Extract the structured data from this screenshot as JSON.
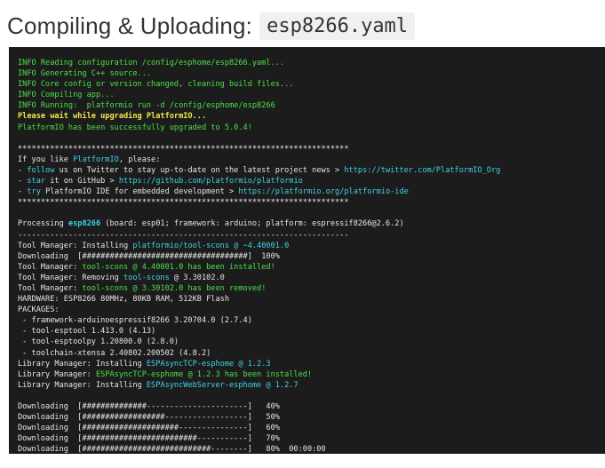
{
  "header": {
    "title": "Compiling & Uploading:",
    "filename": "esp8266.yaml"
  },
  "colors": {
    "terminal_bg": "#1c1c1c",
    "white": "#e6e6e6",
    "green": "#4ae04a",
    "yellow": "#f1e84b",
    "cyan": "#3fd3e6"
  },
  "terminal": {
    "lines": [
      [
        {
          "t": "INFO Reading configuration /config/esphome/esp8266.yaml...",
          "c": "green"
        }
      ],
      [
        {
          "t": "INFO Generating C++ source...",
          "c": "green"
        }
      ],
      [
        {
          "t": "INFO Core config or version changed, cleaning build files...",
          "c": "green"
        }
      ],
      [
        {
          "t": "INFO Compiling app...",
          "c": "green"
        }
      ],
      [
        {
          "t": "INFO Running:  platformio run -d /config/esphome/esp8266",
          "c": "green"
        }
      ],
      [
        {
          "t": "Please wait while upgrading PlatformIO...",
          "c": "yellow",
          "b": true
        }
      ],
      [
        {
          "t": "PlatformIO has been successfully upgraded to 5.0.4!",
          "c": "green"
        }
      ],
      [],
      [
        {
          "t": "************************************************************************",
          "c": "white"
        }
      ],
      [
        {
          "t": "If you like ",
          "c": "white"
        },
        {
          "t": "PlatformIO",
          "c": "cyan"
        },
        {
          "t": ", please:",
          "c": "white"
        }
      ],
      [
        {
          "t": "- ",
          "c": "white"
        },
        {
          "t": "follow",
          "c": "cyan"
        },
        {
          "t": " us on Twitter to stay up-to-date on the latest project news > ",
          "c": "white"
        },
        {
          "t": "https://twitter.com/PlatformIO_Org",
          "c": "cyan"
        }
      ],
      [
        {
          "t": "- ",
          "c": "white"
        },
        {
          "t": "star",
          "c": "cyan"
        },
        {
          "t": " it on GitHub > ",
          "c": "white"
        },
        {
          "t": "https://github.com/platformio/platformio",
          "c": "cyan"
        }
      ],
      [
        {
          "t": "- ",
          "c": "white"
        },
        {
          "t": "try",
          "c": "cyan"
        },
        {
          "t": " PlatformIO IDE for embedded development > ",
          "c": "white"
        },
        {
          "t": "https://platformio.org/platformio-ide",
          "c": "cyan"
        }
      ],
      [
        {
          "t": "************************************************************************",
          "c": "white"
        }
      ],
      [],
      [
        {
          "t": "Processing ",
          "c": "white"
        },
        {
          "t": "esp8266",
          "c": "cyan",
          "b": true
        },
        {
          "t": " (board: esp01; framework: arduino; platform: espressif8266@2.6.2)",
          "c": "white"
        }
      ],
      [
        {
          "t": "------------------------------------------------------------------------",
          "c": "white"
        }
      ],
      [
        {
          "t": "Tool Manager: Installing ",
          "c": "white"
        },
        {
          "t": "platformio/tool-scons @ ~4.40001.0",
          "c": "cyan"
        }
      ],
      [
        {
          "t": "Downloading  [####################################]  100%",
          "c": "white"
        }
      ],
      [
        {
          "t": "Tool Manager: ",
          "c": "white"
        },
        {
          "t": "tool-scons @ 4.40001.0 has been installed!",
          "c": "green"
        }
      ],
      [
        {
          "t": "Tool Manager: Removing ",
          "c": "white"
        },
        {
          "t": "tool-scons",
          "c": "cyan"
        },
        {
          "t": " @ 3.30102.0",
          "c": "white"
        }
      ],
      [
        {
          "t": "Tool Manager: ",
          "c": "white"
        },
        {
          "t": "tool-scons @ 3.30102.0 has been removed!",
          "c": "green"
        }
      ],
      [
        {
          "t": "HARDWARE: ESP8266 80MHz, 80KB RAM, 512KB Flash",
          "c": "white"
        }
      ],
      [
        {
          "t": "PACKAGES:",
          "c": "white"
        }
      ],
      [
        {
          "t": " - framework-arduinoespressif8266 3.20704.0 (2.7.4)",
          "c": "white"
        }
      ],
      [
        {
          "t": " - tool-esptool 1.413.0 (4.13)",
          "c": "white"
        }
      ],
      [
        {
          "t": " - tool-esptoolpy 1.20800.0 (2.8.0)",
          "c": "white"
        }
      ],
      [
        {
          "t": " - toolchain-xtensa 2.40802.200502 (4.8.2)",
          "c": "white"
        }
      ],
      [
        {
          "t": "Library Manager: Installing ",
          "c": "white"
        },
        {
          "t": "ESPAsyncTCP-esphome @ 1.2.3",
          "c": "cyan"
        }
      ],
      [
        {
          "t": "Library Manager: ",
          "c": "white"
        },
        {
          "t": "ESPAsyncTCP-esphome @ 1.2.3 has been installed!",
          "c": "green"
        }
      ],
      [
        {
          "t": "Library Manager: Installing ",
          "c": "white"
        },
        {
          "t": "ESPAsyncWebServer-esphome @ 1.2.7",
          "c": "cyan"
        }
      ],
      [],
      [
        {
          "t": "Downloading  [##############----------------------]   40%",
          "c": "white"
        }
      ],
      [
        {
          "t": "Downloading  [##################------------------]   50%",
          "c": "white"
        }
      ],
      [
        {
          "t": "Downloading  [#####################---------------]   60%",
          "c": "white"
        }
      ],
      [
        {
          "t": "Downloading  [#########################-----------]   70%",
          "c": "white"
        }
      ],
      [
        {
          "t": "Downloading  [############################--------]   80%  00:00:00",
          "c": "white"
        }
      ]
    ]
  }
}
